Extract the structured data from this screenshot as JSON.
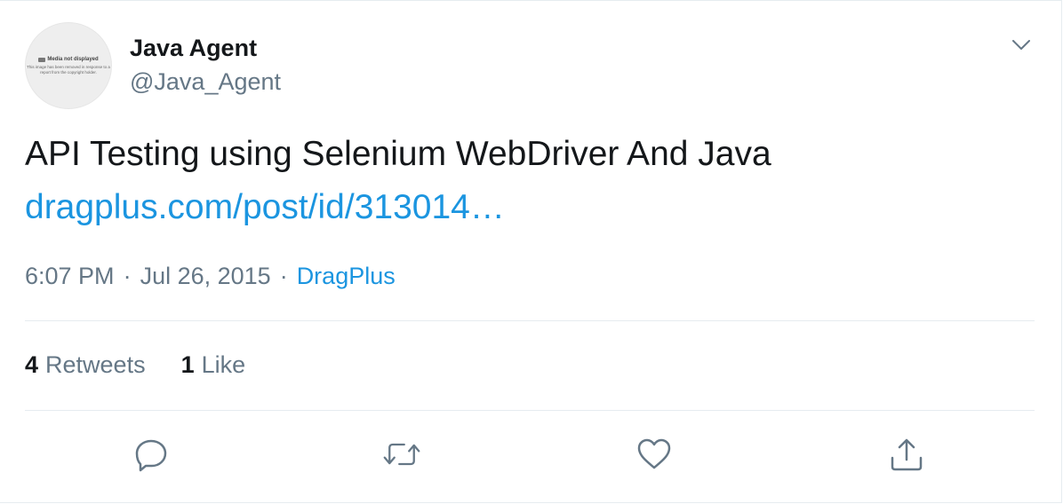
{
  "author": {
    "display_name": "Java Agent",
    "handle": "@Java_Agent",
    "avatar": {
      "title": "Media not displayed",
      "text": "This image has been removed in response to a report from the copyright holder."
    }
  },
  "tweet": {
    "text": "API Testing using Selenium WebDriver And Java",
    "link": "dragplus.com/post/id/313014…",
    "time": "6:07 PM",
    "date": "Jul 26, 2015",
    "separator": "·",
    "source": "DragPlus"
  },
  "stats": {
    "retweets_count": "4",
    "retweets_label": "Retweets",
    "likes_count": "1",
    "likes_label": "Like"
  },
  "actions": {
    "icons": [
      "reply-icon",
      "retweet-icon",
      "like-icon",
      "share-icon",
      "chevron-down-icon"
    ],
    "icon_color": "#657786"
  },
  "colors": {
    "text": "#14171a",
    "secondary": "#657786",
    "link": "#1b95e0",
    "border": "#e6ecf0"
  }
}
